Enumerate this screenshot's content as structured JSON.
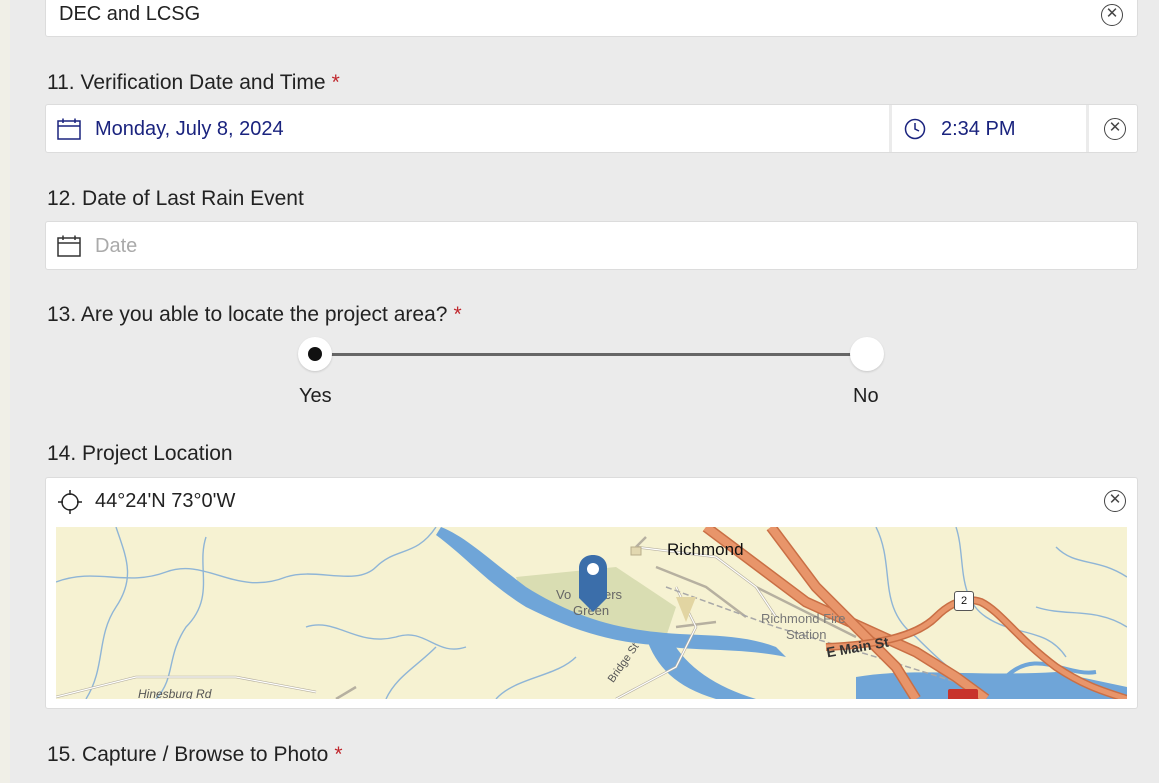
{
  "q10": {
    "value": "DEC and LCSG"
  },
  "q11": {
    "label": "11. Verification Date and Time",
    "required": "*",
    "date": "Monday, July 8, 2024",
    "time": "2:34 PM"
  },
  "q12": {
    "label": "12. Date of Last Rain Event",
    "placeholder": "Date"
  },
  "q13": {
    "label": "13. Are you able to locate the project area?",
    "required": "*",
    "options": [
      "Yes",
      "No"
    ],
    "selected": "Yes"
  },
  "q14": {
    "label": "14. Project Location",
    "coords": "44°24'N 73°0'W",
    "map": {
      "place_richmond": "Richmond",
      "place_volunteers_1": "Vo",
      "place_volunteers_2": "ers",
      "place_green": "Green",
      "fire_station_1": "Richmond Fire",
      "fire_station_2": "Station",
      "street_main": "E Main St",
      "street_bridge": "Bridge St",
      "street_hinesburg": "Hinesburg Rd",
      "route_shield": "2"
    }
  },
  "q15": {
    "label": "15. Capture / Browse to Photo",
    "required": "*"
  },
  "colors": {
    "accent_blue": "#1a237e",
    "required_red": "#c0272d",
    "map_pin": "#3b6eaa",
    "highway": "#e0875a"
  }
}
